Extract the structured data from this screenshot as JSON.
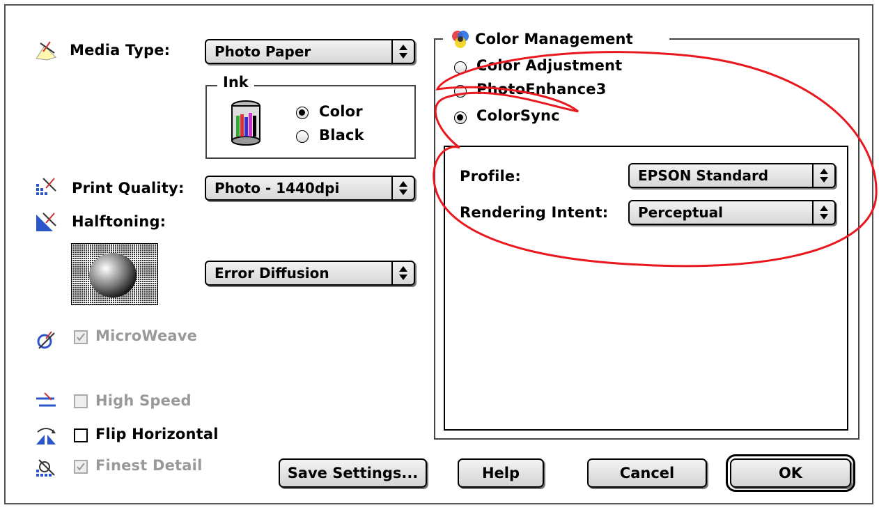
{
  "left": {
    "media_type_label": "Media Type:",
    "media_type_value": "Photo Paper",
    "ink_title": "Ink",
    "ink_color": "Color",
    "ink_black": "Black",
    "print_quality_label": "Print Quality:",
    "print_quality_value": "Photo - 1440dpi",
    "halftoning_label": "Halftoning:",
    "halftoning_value": "Error Diffusion",
    "microweave": "MicroWeave",
    "high_speed": "High Speed",
    "flip_horizontal": "Flip Horizontal",
    "finest_detail": "Finest Detail"
  },
  "color_management": {
    "title": "Color Management",
    "options": [
      "Color Adjustment",
      "PhotoEnhance3",
      "ColorSync"
    ],
    "selected": "ColorSync",
    "profile_label": "Profile:",
    "profile_value": "EPSON Standard",
    "rendering_label": "Rendering Intent:",
    "rendering_value": "Perceptual"
  },
  "buttons": {
    "save": "Save Settings...",
    "help": "Help",
    "cancel": "Cancel",
    "ok": "OK"
  },
  "colors": {
    "highlight_ellipse": "#e8181e"
  }
}
